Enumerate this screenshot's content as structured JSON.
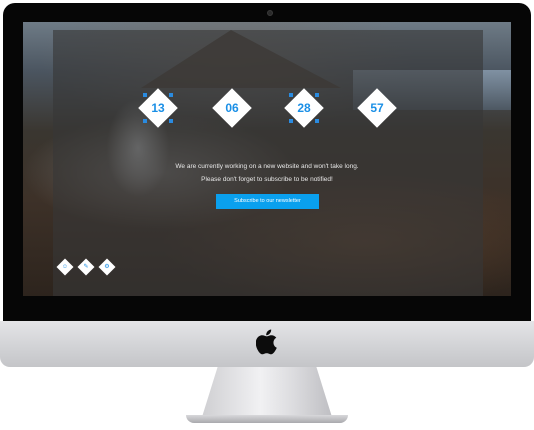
{
  "countdown": {
    "days": "13",
    "hours": "06",
    "minutes": "28",
    "seconds": "57"
  },
  "message": {
    "line1": "We are currently working on a new website and won't take long.",
    "line2": "Please don't forget to subscribe to be notified!"
  },
  "subscribe": {
    "label": "Subscribe to our newsletter"
  },
  "social": {
    "icons": [
      "user-icon",
      "pencil-icon",
      "gear-icon"
    ],
    "glyphs": [
      "☺",
      "✎",
      "⚙"
    ]
  },
  "colors": {
    "accent": "#1a8fe6",
    "button": "#0aa0ee"
  }
}
